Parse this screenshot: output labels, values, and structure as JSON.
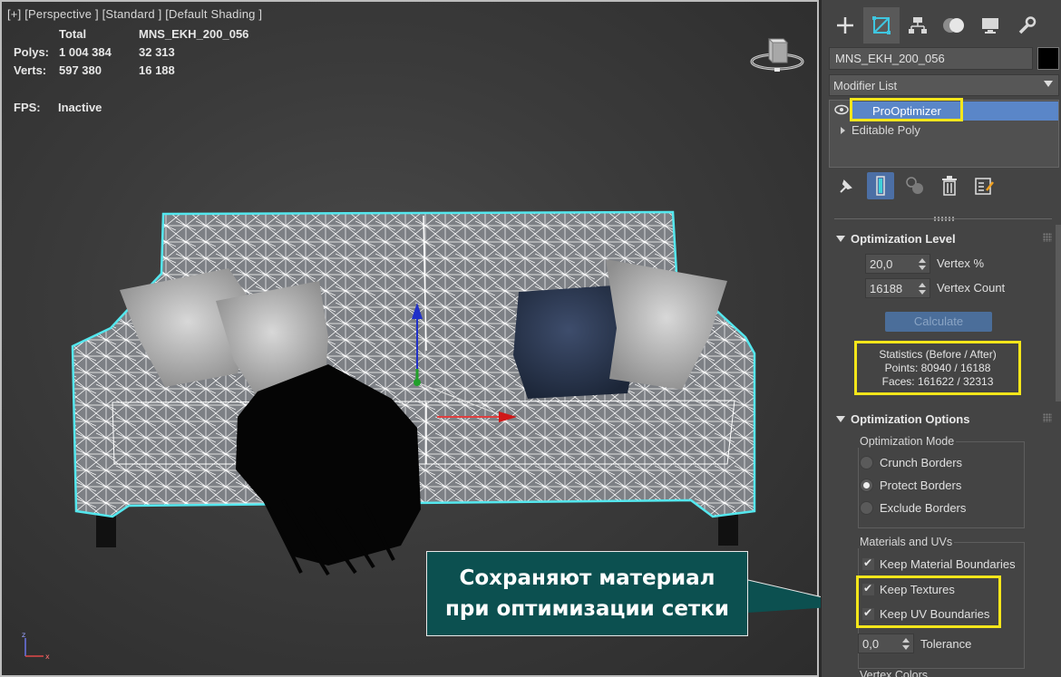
{
  "viewport": {
    "label_plus": "[+]",
    "label_view": "[Perspective ]",
    "label_standard": "[Standard ]",
    "label_shading": "[Default Shading ]",
    "stats": {
      "header_total": "Total",
      "header_object": "MNS_EKH_200_056",
      "polys_label": "Polys:",
      "polys_total": "1 004 384",
      "polys_object": "32 313",
      "verts_label": "Verts:",
      "verts_total": "597 380",
      "verts_object": "16 188"
    },
    "fps_label": "FPS:",
    "fps_value": "Inactive"
  },
  "callout": {
    "text": "Сохраняют материал\nпри оптимизации сетки"
  },
  "panel": {
    "tabs": [
      "create-tab",
      "modify-tab",
      "hierarchy-tab",
      "motion-tab",
      "display-tab",
      "utilities-tab"
    ],
    "object_name": "MNS_EKH_200_056",
    "object_color": "#000000",
    "modifier_list": "Modifier List",
    "stack": {
      "selected": "ProOptimizer",
      "base": "Editable Poly"
    },
    "optimization_level": {
      "title": "Optimization Level",
      "vertex_pct_value": "20,0",
      "vertex_pct_label": "Vertex %",
      "vertex_count_value": "16188",
      "vertex_count_label": "Vertex Count",
      "calculate": "Calculate",
      "stats_title": "Statistics (Before / After)",
      "stats_points": "Points: 80940 / 16188",
      "stats_faces": "Faces: 161622 / 32313"
    },
    "optimization_options": {
      "title": "Optimization Options",
      "mode_group": "Optimization Mode",
      "crunch": "Crunch Borders",
      "protect": "Protect Borders",
      "exclude": "Exclude Borders",
      "mat_group": "Materials and UVs",
      "keep_mat": "Keep Material Boundaries",
      "keep_tex": "Keep Textures",
      "keep_uv": "Keep UV Boundaries",
      "tolerance_value": "0,0",
      "tolerance_label": "Tolerance",
      "next_group": "Vertex Colors"
    }
  },
  "colors": {
    "highlight": "#f4e61a",
    "callout_bg": "#0c5050",
    "selection": "#5a86c8"
  }
}
